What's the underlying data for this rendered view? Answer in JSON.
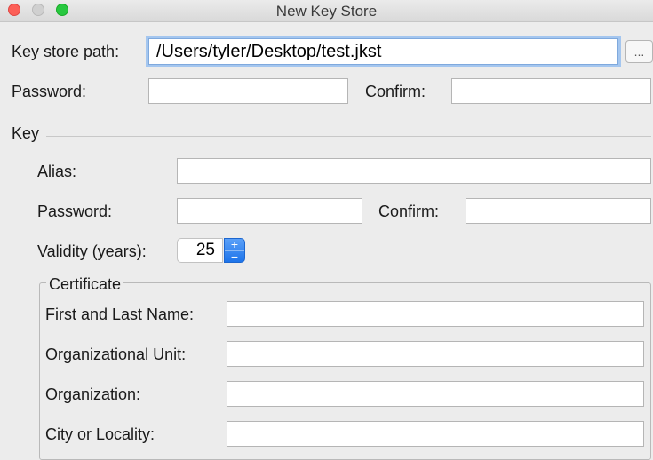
{
  "window": {
    "title": "New Key Store"
  },
  "key_store": {
    "path_label": "Key store path:",
    "path_value": "/Users/tyler/Desktop/test.jkst",
    "browse_label": "...",
    "password_label": "Password:",
    "password_value": "",
    "confirm_label": "Confirm:",
    "confirm_value": ""
  },
  "key": {
    "section_label": "Key",
    "alias_label": "Alias:",
    "alias_value": "",
    "password_label": "Password:",
    "password_value": "",
    "confirm_label": "Confirm:",
    "confirm_value": "",
    "validity_label": "Validity (years):",
    "validity_value": "25",
    "increment_symbol": "+",
    "decrement_symbol": "−"
  },
  "certificate": {
    "group_label": "Certificate",
    "fields": [
      {
        "label": "First and Last Name:",
        "value": ""
      },
      {
        "label": "Organizational Unit:",
        "value": ""
      },
      {
        "label": "Organization:",
        "value": ""
      },
      {
        "label": "City or Locality:",
        "value": ""
      }
    ]
  }
}
